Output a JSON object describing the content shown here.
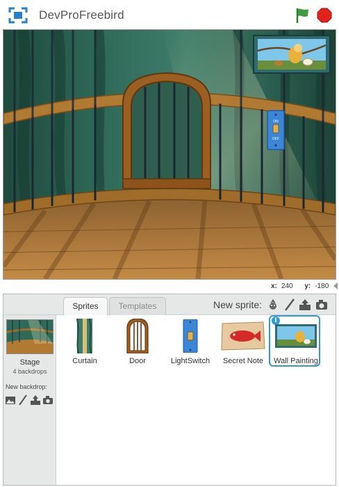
{
  "header": {
    "title": "DevProFreebird"
  },
  "coords": {
    "x_label": "x:",
    "x_value": "240",
    "y_label": "y:",
    "y_value": "-180"
  },
  "stage_switch": {
    "on": "ON",
    "off": "OFF"
  },
  "tabs": [
    {
      "label": "Sprites",
      "active": true
    },
    {
      "label": "Templates",
      "active": false
    }
  ],
  "new_sprite": {
    "label": "New sprite:",
    "icons": [
      "choose-from-library-icon",
      "paint-new-sprite-icon",
      "upload-sprite-icon",
      "camera-icon"
    ]
  },
  "stage_panel": {
    "label": "Stage",
    "sub": "4 backdrops",
    "new_backdrop_label": "New backdrop:",
    "icons": [
      "backdrop-library-icon",
      "paint-backdrop-icon",
      "upload-backdrop-icon",
      "camera-icon"
    ]
  },
  "sprites": [
    {
      "name": "Curtain",
      "selected": false
    },
    {
      "name": "Door",
      "selected": false
    },
    {
      "name": "LightSwitch",
      "selected": false
    },
    {
      "name": "Secret Note",
      "selected": false
    },
    {
      "name": "Wall Painting",
      "selected": true
    }
  ],
  "colors": {
    "accent": "#2f9ad7",
    "flag": "#3f9b3f",
    "stop": "#e0241c",
    "pane_bg": "#e6e8e8"
  }
}
